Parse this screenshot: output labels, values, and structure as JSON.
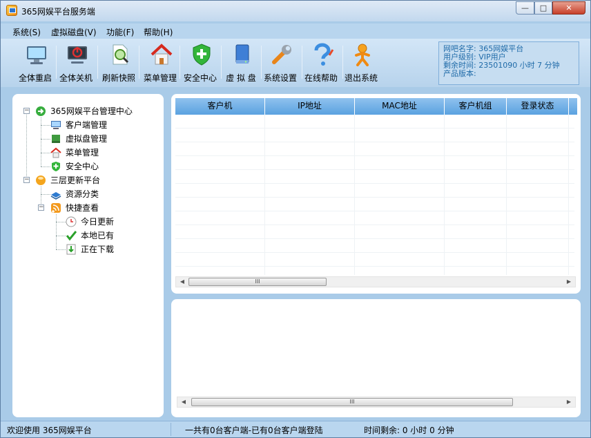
{
  "window": {
    "title": "365网娱平台服务端",
    "min_label": "▭",
    "max_label": "□",
    "close_label": "✕"
  },
  "menu": [
    {
      "label": "系统(S)"
    },
    {
      "label": "虚拟磁盘(V)"
    },
    {
      "label": "功能(F)"
    },
    {
      "label": "帮助(H)"
    }
  ],
  "toolbar": [
    {
      "label": "全体重启",
      "icon": "monitor-icon"
    },
    {
      "label": "全体关机",
      "icon": "power-off-icon"
    },
    {
      "label": "刷新快照",
      "icon": "snapshot-icon"
    },
    {
      "label": "菜单管理",
      "icon": "house-icon"
    },
    {
      "label": "安全中心",
      "icon": "shield-icon"
    },
    {
      "label": "虚 拟 盘",
      "icon": "disk-icon"
    },
    {
      "label": "系统设置",
      "icon": "wrench-icon"
    },
    {
      "label": "在线帮助",
      "icon": "help-icon"
    },
    {
      "label": "退出系统",
      "icon": "exit-icon"
    }
  ],
  "info": {
    "line1": "网吧名字: 365网娱平台",
    "line2": "用户级别: VIP用户",
    "line3": "剩余时间: 23501090 小时 7 分钟",
    "line4": "产品版本:"
  },
  "tree": {
    "root": "365网娱平台管理中心",
    "children": [
      "客户端管理",
      "虚拟盘管理",
      "菜单管理",
      "安全中心"
    ],
    "root2": "三层更新平台",
    "children2": [
      "资源分类",
      "快捷查看"
    ],
    "sub": [
      "今日更新",
      "本地已有",
      "正在下载"
    ],
    "toggle_minus": "−"
  },
  "table": {
    "columns": [
      "客户机",
      "IP地址",
      "MAC地址",
      "客户机组",
      "登录状态"
    ],
    "scroll_grip": "III",
    "arrow_left": "◀",
    "arrow_right": "▶"
  },
  "status": {
    "welcome": "欢迎使用 365网娱平台",
    "clients": "一共有0台客户端-已有0台客户端登陆",
    "time": "时间剩余: 0 小时 0 分钟"
  },
  "colors": {
    "accent": "#5aa2e0",
    "frame": "#a9cbe8",
    "info_text": "#1e6aa8"
  }
}
